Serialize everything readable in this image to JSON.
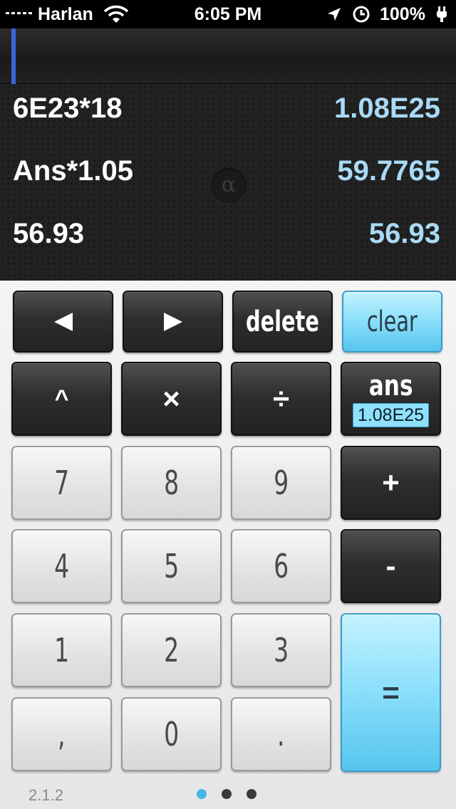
{
  "status_bar": {
    "carrier": "Harlan",
    "time": "6:05 PM",
    "battery": "100%",
    "icons": [
      "signal-icon",
      "wifi-icon",
      "location-arrow-icon",
      "alarm-clock-icon",
      "charging-plug-icon"
    ]
  },
  "input": {
    "value": ""
  },
  "history": [
    {
      "expression": "6E23*18",
      "result": "1.08E25"
    },
    {
      "expression": "Ans*1.05",
      "result": "59.7765"
    },
    {
      "expression": "56.93",
      "result": "56.93"
    }
  ],
  "alpha_button": {
    "label": "α"
  },
  "keys": {
    "left": "◀",
    "right": "▶",
    "delete": "delete",
    "clear": "clear",
    "power": "^",
    "multiply": "×",
    "divide": "÷",
    "ans_label": "ans",
    "ans_value": "1.08E25",
    "seven": "7",
    "eight": "8",
    "nine": "9",
    "plus": "+",
    "four": "4",
    "five": "5",
    "six": "6",
    "minus": "-",
    "one": "1",
    "two": "2",
    "three": "3",
    "equals": "=",
    "comma": ",",
    "zero": "0",
    "decimal": "."
  },
  "footer": {
    "version": "2.1.2",
    "page_count": 3,
    "active_page": 1
  },
  "colors": {
    "accent_blue": "#8fe1fb",
    "result_text": "#a9daf6",
    "cursor": "#3d63dc",
    "active_dot": "#45b6e8"
  }
}
